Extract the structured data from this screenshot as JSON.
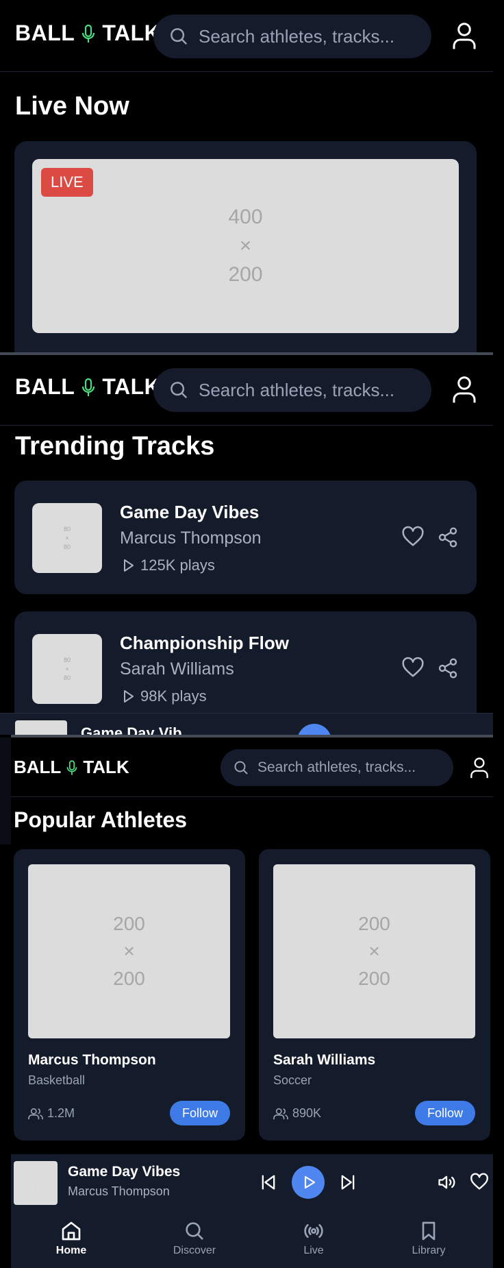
{
  "app": {
    "logo_left": "BALL",
    "logo_right": "TALK",
    "accent": "#4ade80"
  },
  "search": {
    "placeholder": "Search athletes, tracks..."
  },
  "live": {
    "heading": "Live Now",
    "badge": "LIVE",
    "image": {
      "line1": "400",
      "line2": "×",
      "line3": "200"
    }
  },
  "trending": {
    "heading": "Trending Tracks",
    "tracks": [
      {
        "title": "Game Day Vibes",
        "artist": "Marcus Thompson",
        "plays": "125K plays",
        "thumb": {
          "w": "80",
          "x": "×",
          "h": "80"
        }
      },
      {
        "title": "Championship Flow",
        "artist": "Sarah Williams",
        "plays": "98K plays",
        "thumb": {
          "w": "80",
          "x": "×",
          "h": "80"
        }
      }
    ],
    "peek_title": "Game Day Vib"
  },
  "athletes": {
    "heading": "Popular Athletes",
    "items": [
      {
        "name": "Marcus Thompson",
        "sport": "Basketball",
        "followers": "1.2M",
        "follow_label": "Follow",
        "image": {
          "w": "200",
          "x": "×",
          "h": "200"
        }
      },
      {
        "name": "Sarah Williams",
        "sport": "Soccer",
        "followers": "890K",
        "follow_label": "Follow",
        "image": {
          "w": "200",
          "x": "×",
          "h": "200"
        }
      }
    ]
  },
  "player": {
    "title": "Game Day Vibes",
    "artist": "Marcus Thompson"
  },
  "nav": [
    {
      "label": "Home",
      "icon": "home-icon",
      "active": true
    },
    {
      "label": "Discover",
      "icon": "search-icon",
      "active": false
    },
    {
      "label": "Live",
      "icon": "broadcast-icon",
      "active": false
    },
    {
      "label": "Library",
      "icon": "bookmark-icon",
      "active": false
    }
  ],
  "colors": {
    "live": "#dc4a44",
    "follow": "#3f7be6",
    "card": "#141b2b",
    "play": "#4f86f0"
  }
}
